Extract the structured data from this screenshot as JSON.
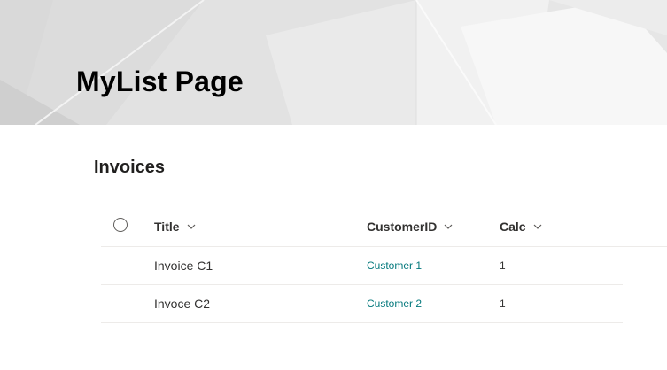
{
  "page": {
    "title": "MyList Page"
  },
  "section": {
    "title": "Invoices"
  },
  "list": {
    "columns": [
      {
        "label": "Title"
      },
      {
        "label": "CustomerID"
      },
      {
        "label": "Calc"
      }
    ],
    "rows": [
      {
        "title": "Invoice C1",
        "customer": "Customer 1",
        "calc": "1"
      },
      {
        "title": "Invoce C2",
        "customer": "Customer 2",
        "calc": "1"
      }
    ]
  },
  "colors": {
    "link": "#03787c",
    "divider": "#edebe9",
    "banner": "#e8e8e8"
  }
}
